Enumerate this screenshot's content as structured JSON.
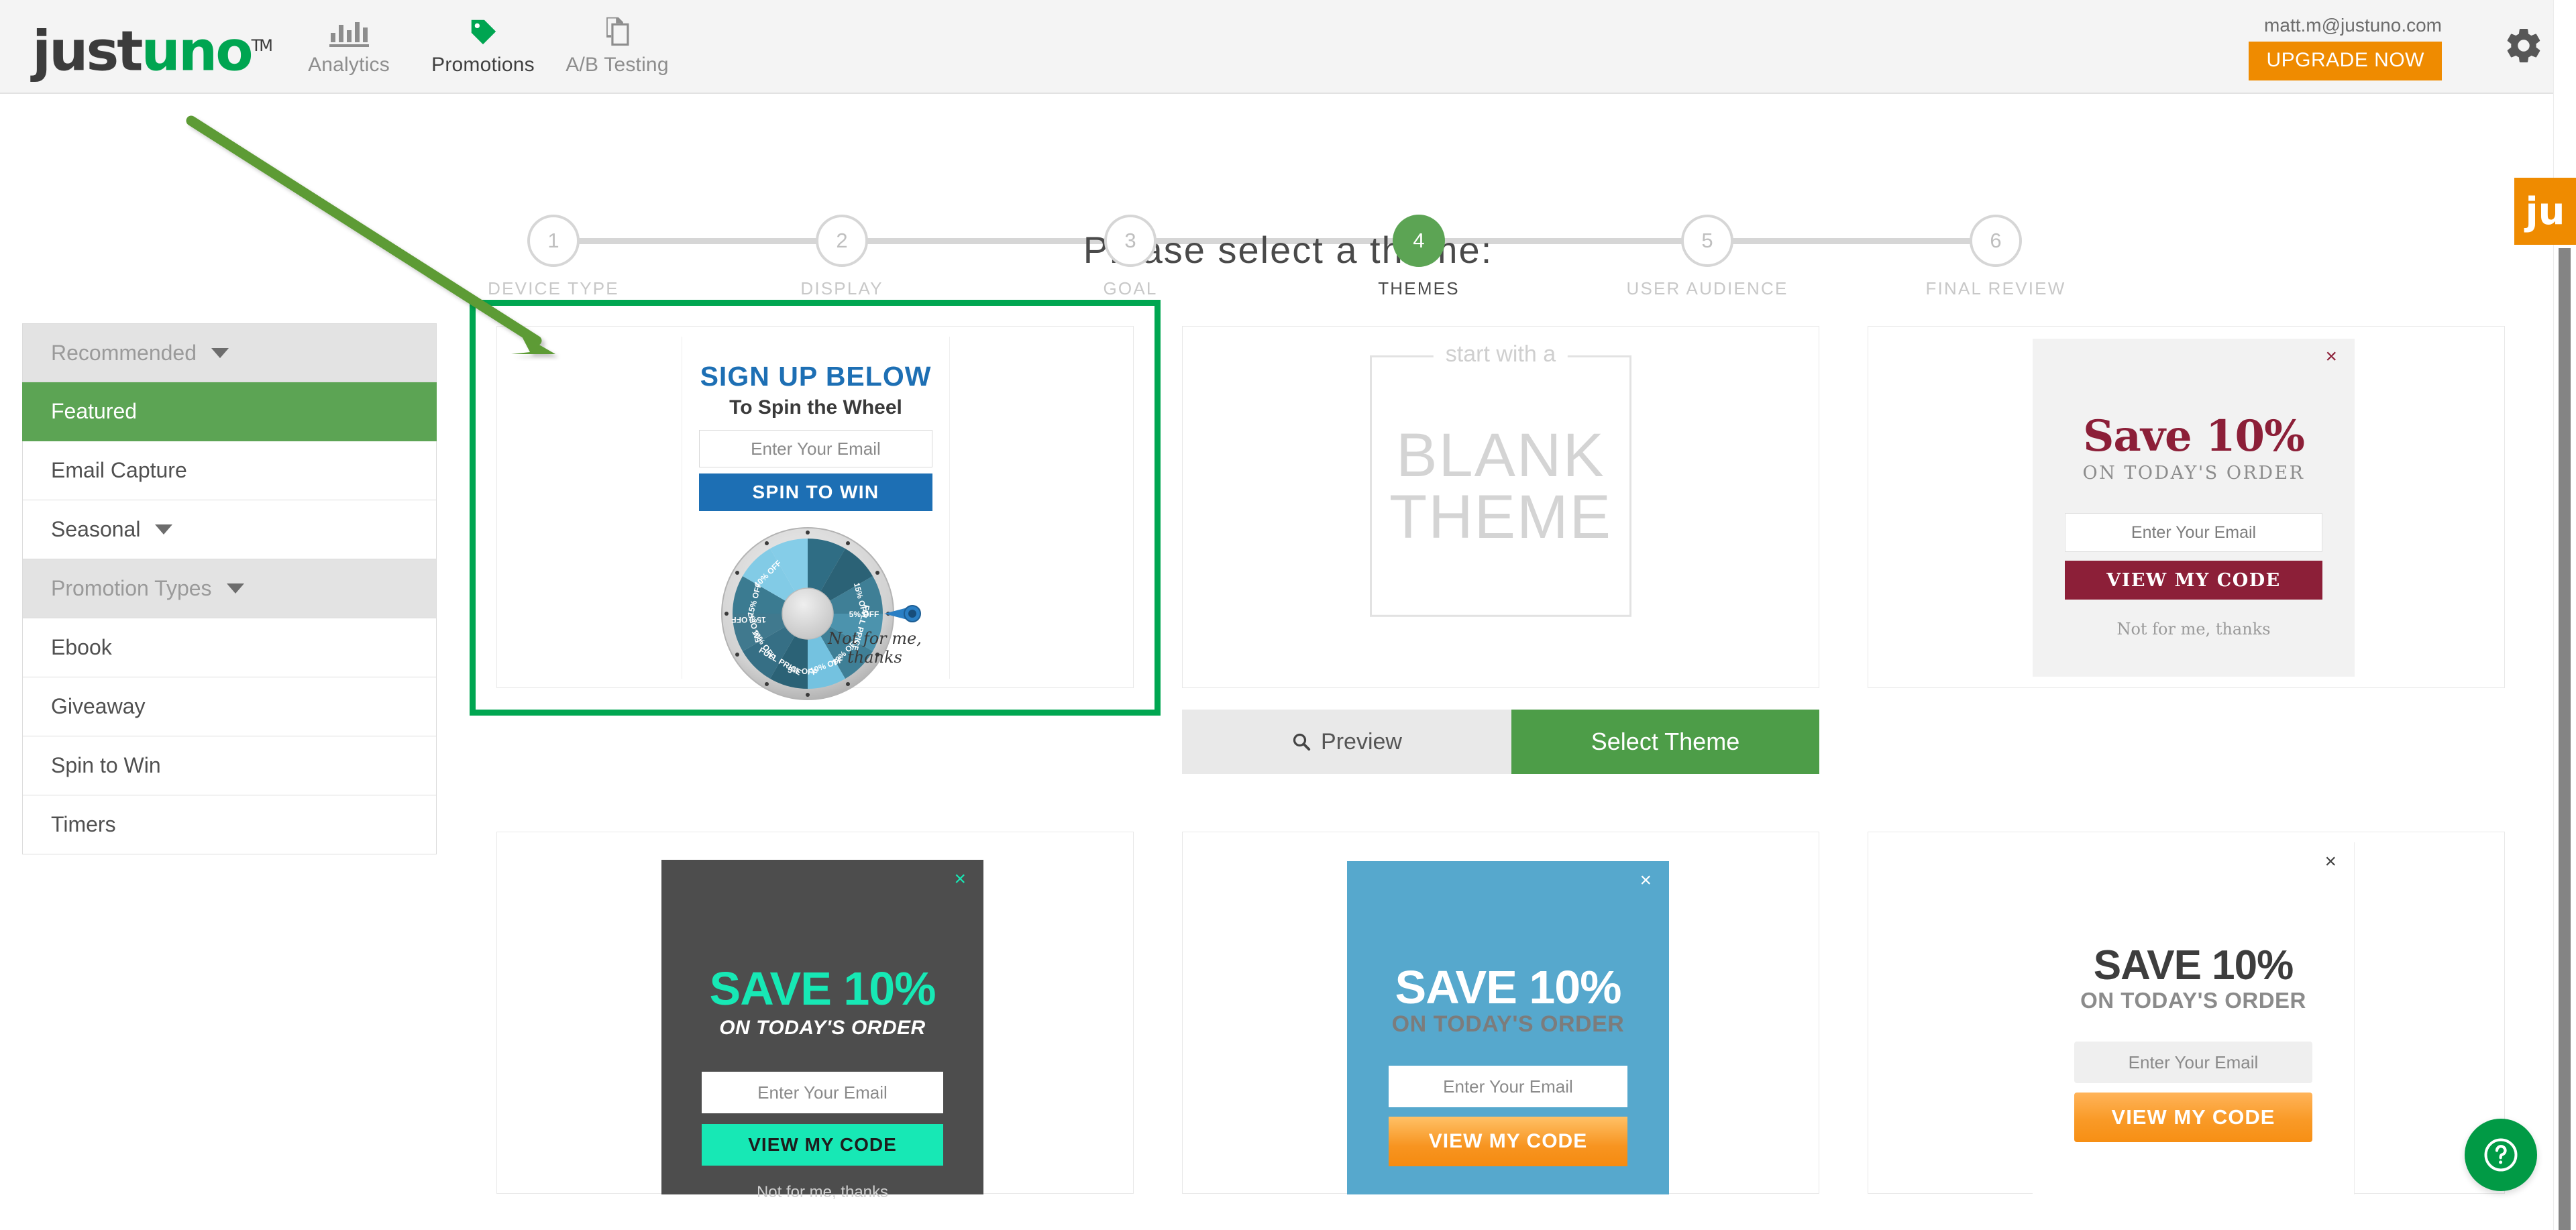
{
  "topnav": {
    "logo_text_dark": "just",
    "logo_text_green": "uno",
    "logo_tm": "TM",
    "items": [
      {
        "label": "Analytics",
        "icon": "bar-chart-icon",
        "active": false
      },
      {
        "label": "Promotions",
        "icon": "tag-icon",
        "active": true
      },
      {
        "label": "A/B Testing",
        "icon": "copy-pages-icon",
        "active": false
      }
    ],
    "account_email": "matt.m@justuno.com",
    "upgrade_label": "UPGRADE NOW",
    "gear_icon": "gear-icon"
  },
  "stepper": {
    "steps": [
      {
        "num": "1",
        "label": "DEVICE TYPE",
        "active": false
      },
      {
        "num": "2",
        "label": "DISPLAY",
        "active": false
      },
      {
        "num": "3",
        "label": "GOAL",
        "active": false
      },
      {
        "num": "4",
        "label": "THEMES",
        "active": true
      },
      {
        "num": "5",
        "label": "USER AUDIENCE",
        "active": false
      },
      {
        "num": "6",
        "label": "FINAL REVIEW",
        "active": false
      }
    ]
  },
  "page": {
    "title": "Please select a theme:"
  },
  "sidebar": {
    "items": [
      {
        "label": "Recommended",
        "type": "group",
        "caret": true,
        "active": false
      },
      {
        "label": "Featured",
        "type": "item",
        "caret": false,
        "active": true
      },
      {
        "label": "Email Capture",
        "type": "item",
        "caret": false,
        "active": false
      },
      {
        "label": "Seasonal",
        "type": "item",
        "caret": true,
        "active": false
      },
      {
        "label": "Promotion Types",
        "type": "group",
        "caret": true,
        "active": false
      },
      {
        "label": "Ebook",
        "type": "item",
        "caret": false,
        "active": false
      },
      {
        "label": "Giveaway",
        "type": "item",
        "caret": false,
        "active": false
      },
      {
        "label": "Spin to Win",
        "type": "item",
        "caret": false,
        "active": false
      },
      {
        "label": "Timers",
        "type": "item",
        "caret": false,
        "active": false
      }
    ]
  },
  "themes": {
    "card1": {
      "name": "spin-to-win-theme",
      "title": "SIGN UP BELOW",
      "subtitle": "To Spin the Wheel",
      "email_placeholder": "Enter Your Email",
      "cta": "SPIN TO WIN",
      "decline": "Not for me, thanks",
      "title_color": "#1d6fb4",
      "cta_color": "#1d6fb4",
      "selected": true,
      "wheel_segments": [
        "15% OFF",
        "FULL PRICE",
        "5% OFF",
        "20% OFF",
        "10% OFF",
        "5% OFF",
        "FULL PRICE",
        "10% OFF",
        "15% OFF",
        "5% OFF",
        "15% OFF",
        "10% OFF"
      ],
      "wheel_pointer_at": "5% OFF"
    },
    "card2": {
      "name": "blank-theme",
      "small_text": "start with a",
      "big_line1": "BLANK",
      "big_line2": "THEME",
      "preview_label": "Preview",
      "select_label": "Select Theme",
      "preview_icon": "magnifier-icon",
      "select_color": "#4d9d48"
    },
    "card3": {
      "name": "save-10-serif-theme",
      "close": "×",
      "headline": "Save 10%",
      "subhead": "ON TODAY'S ORDER",
      "email_placeholder": "Enter Your Email",
      "cta": "VIEW MY CODE",
      "decline": "Not for me, thanks",
      "accent_color": "#8c1f38",
      "background_color": "#f2f2f2"
    },
    "card4": {
      "name": "save-10-dark-teal-theme",
      "close": "×",
      "headline": "SAVE 10%",
      "subhead": "ON TODAY'S ORDER",
      "email_placeholder": "Enter Your Email",
      "cta": "VIEW MY CODE",
      "decline": "Not for me, thanks",
      "accent_color": "#17e8b5",
      "background_color": "#4d4d4d"
    },
    "card5": {
      "name": "save-10-blue-theme",
      "close": "×",
      "headline": "SAVE 10%",
      "subhead": "ON TODAY'S ORDER",
      "email_placeholder": "Enter Your Email",
      "cta": "VIEW MY CODE",
      "accent_color": "#f79420",
      "background_color": "#56a8cd"
    },
    "card6": {
      "name": "save-10-white-orange-theme",
      "close": "×",
      "headline": "SAVE 10%",
      "subhead": "ON TODAY'S ORDER",
      "email_placeholder": "Enter Your Email",
      "cta": "VIEW MY CODE",
      "accent_color": "#f99a27",
      "background_color": "#ffffff"
    }
  },
  "right_rail": {
    "ju_tab_label": "ju",
    "ju_tab_color": "#ef8b00",
    "help_icon": "question-mark-icon",
    "help_color": "#019a45"
  },
  "annotation": {
    "arrow_color": "#5d9b35",
    "highlight_color": "#00a651",
    "target": "spin-to-win-theme"
  }
}
